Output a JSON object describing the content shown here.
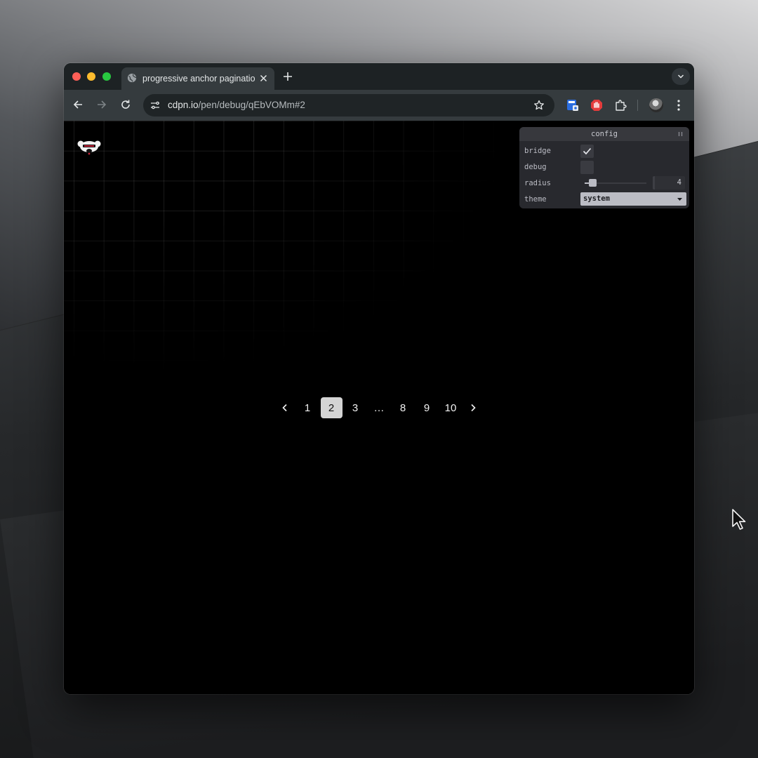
{
  "browser": {
    "tab_title": "progressive anchor pagination",
    "url_host": "cdpn.io",
    "url_path": "/pen/debug/qEbVOMm#2"
  },
  "pagination": {
    "items": [
      "1",
      "2",
      "3",
      "…",
      "8",
      "9",
      "10"
    ],
    "active": "2"
  },
  "config": {
    "title": "config",
    "bridge_label": "bridge",
    "bridge_checked": true,
    "debug_label": "debug",
    "debug_checked": false,
    "radius_label": "radius",
    "radius_value": "4",
    "radius_fraction": 0.12,
    "theme_label": "theme",
    "theme_value": "system"
  },
  "colors": {
    "active_page_bg": "#d4d4d4",
    "panel_bg": "#28292e"
  }
}
